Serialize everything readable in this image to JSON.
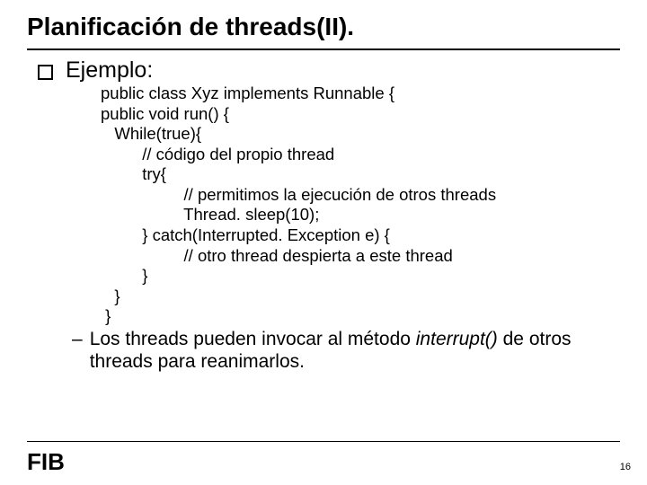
{
  "title": "Planificación de threads(II).",
  "bullet1": "Ejemplo:",
  "code_lines": {
    "l0": "public class Xyz implements Runnable {",
    "l1": "public void run() {",
    "l2": "   While(true){",
    "l3": "         // código del propio thread",
    "l4": "         try{",
    "l5": "                  // permitimos la ejecución de otros threads",
    "l6": "                  Thread. sleep(10);",
    "l7": "         } catch(Interrupted. Exception e) {",
    "l8": "                  // otro thread despierta a este thread",
    "l9": "         }",
    "l10": "   }",
    "l11": " }"
  },
  "bullet2_pre": "Los threads pueden invocar al método ",
  "bullet2_em": "interrupt()",
  "bullet2_post": " de otros threads para reanimarlos.",
  "logo": "FIB",
  "page_number": "16"
}
